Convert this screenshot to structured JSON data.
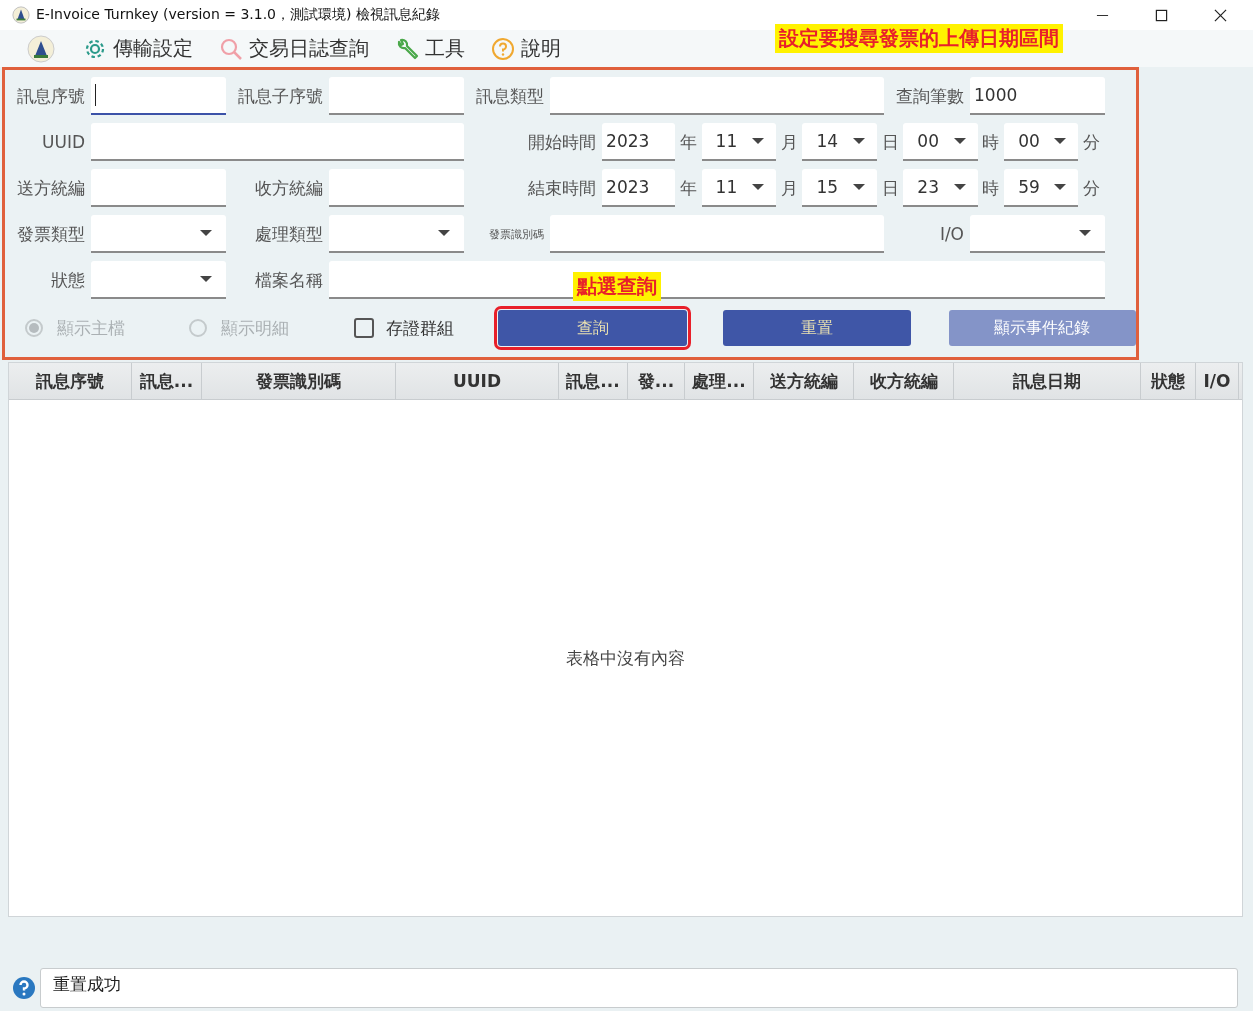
{
  "window": {
    "title": "E-Invoice Turnkey (version = 3.1.0，測試環境) 檢視訊息紀錄"
  },
  "menu": [
    {
      "label": "傳輸設定",
      "kind": "settings"
    },
    {
      "label": "交易日誌查詢",
      "kind": "search"
    },
    {
      "label": "工具",
      "kind": "tools"
    },
    {
      "label": "說明",
      "kind": "help"
    }
  ],
  "form": {
    "msg_seq": {
      "label": "訊息序號",
      "focused": true
    },
    "msg_sub_seq": {
      "label": "訊息子序號",
      "focused": false
    },
    "msg_type": {
      "label": "訊息類型",
      "focused": false
    },
    "query_count": {
      "label": "查詢筆數",
      "value": "1000",
      "focused": false
    },
    "uuid": {
      "label": "UUID",
      "focused": false
    },
    "start_time": {
      "label": "開始時間",
      "parts": [
        {
          "kind": "text",
          "value": "2023",
          "unit": "年"
        },
        {
          "kind": "select",
          "value": "11",
          "unit": "月"
        },
        {
          "kind": "select",
          "value": "14",
          "unit": "日"
        },
        {
          "kind": "select",
          "value": "00",
          "unit": "時"
        },
        {
          "kind": "select",
          "value": "00",
          "unit": "分"
        }
      ]
    },
    "sender_id": {
      "label": "送方統編",
      "focused": false
    },
    "receiver_id": {
      "label": "收方統編",
      "focused": false
    },
    "end_time": {
      "label": "結束時間",
      "parts": [
        {
          "kind": "text",
          "value": "2023",
          "unit": "年"
        },
        {
          "kind": "select",
          "value": "11",
          "unit": "月"
        },
        {
          "kind": "select",
          "value": "15",
          "unit": "日"
        },
        {
          "kind": "select",
          "value": "23",
          "unit": "時"
        },
        {
          "kind": "select",
          "value": "59",
          "unit": "分"
        }
      ]
    },
    "invoice_type": {
      "label": "發票類型"
    },
    "process_type": {
      "label": "處理類型"
    },
    "invoice_id": {
      "label": "發票識別碼",
      "focused": false
    },
    "io": {
      "label": "I/O"
    },
    "status": {
      "label": "狀態"
    },
    "file_name": {
      "label": "檔案名稱",
      "focused": false
    },
    "radios": [
      {
        "label": "顯示主檔",
        "selected": true,
        "disabled": true
      },
      {
        "label": "顯示明細",
        "selected": false,
        "disabled": true
      }
    ],
    "checkbox": {
      "label": "存證群組",
      "checked": false
    },
    "buttons": [
      {
        "label": "查詢",
        "disabled": false,
        "highlighted": true
      },
      {
        "label": "重置",
        "disabled": false,
        "highlighted": false
      },
      {
        "label": "顯示事件紀錄",
        "disabled": true,
        "highlighted": false
      }
    ]
  },
  "table": {
    "columns": [
      "訊息序號",
      "訊息...",
      "發票識別碼",
      "UUID",
      "訊息...",
      "發...",
      "處理...",
      "送方統編",
      "收方統編",
      "訊息日期",
      "狀態",
      "I/O"
    ],
    "empty_message": "表格中沒有內容"
  },
  "status_bar": {
    "message": "重置成功"
  },
  "annotations": [
    {
      "text": "設定要搜尋發票的上傳日期區間"
    },
    {
      "text": "點選查詢"
    }
  ]
}
